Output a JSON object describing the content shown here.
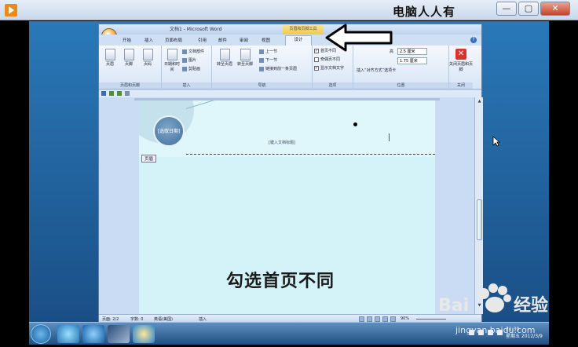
{
  "player": {
    "title": "电脑人人有",
    "buttons": {
      "minimize": "—",
      "maximize": "▢",
      "close": "✕"
    }
  },
  "word": {
    "window_title": "文档1 - Microsoft Word",
    "context_tab": "页眉和页脚工具",
    "tabs": [
      "开始",
      "插入",
      "页面布局",
      "引用",
      "邮件",
      "审阅",
      "视图",
      "设计"
    ],
    "ribbon": {
      "group1": {
        "label": "页眉和页脚",
        "buttons": [
          "页眉",
          "页脚",
          "页码"
        ]
      },
      "group2": {
        "label": "插入",
        "big_button": "日期和时间",
        "items": [
          "文档部件",
          "图片",
          "剪贴画"
        ]
      },
      "group3": {
        "label": "导航",
        "buttons": [
          "转至页眉",
          "转至页脚"
        ],
        "items": [
          "上一节",
          "下一节",
          "链接到前一条页眉"
        ]
      },
      "group4": {
        "label": "选项",
        "checkboxes": [
          {
            "label": "首页不同",
            "checked": true
          },
          {
            "label": "奇偶页不同",
            "checked": false
          },
          {
            "label": "显示文档文字",
            "checked": true
          }
        ]
      },
      "group5": {
        "label": "位置",
        "header_prefix": "高",
        "header_value": "2.5 厘米",
        "footer_value": "1.75 厘米",
        "align_text": "插入“对齐方式”选项卡"
      },
      "group6": {
        "label": "关闭",
        "button": "关闭页眉和页脚"
      }
    },
    "document": {
      "circle_label": "[选取日期]",
      "header_placeholder": "[键入文档标题]",
      "header_tag": "页眉"
    },
    "status": {
      "page": "页面: 2/2",
      "words": "字数: 0",
      "language": "英语(美国)",
      "mode": "插入",
      "zoom": "90%"
    }
  },
  "overlay_caption": "勾选首页不同",
  "taskbar": {
    "clock_time": "21:39",
    "clock_date": "星期五 2012/3/9"
  },
  "watermark": {
    "brand": "Baidu 经验",
    "url": "jingyan.baidu.com"
  }
}
